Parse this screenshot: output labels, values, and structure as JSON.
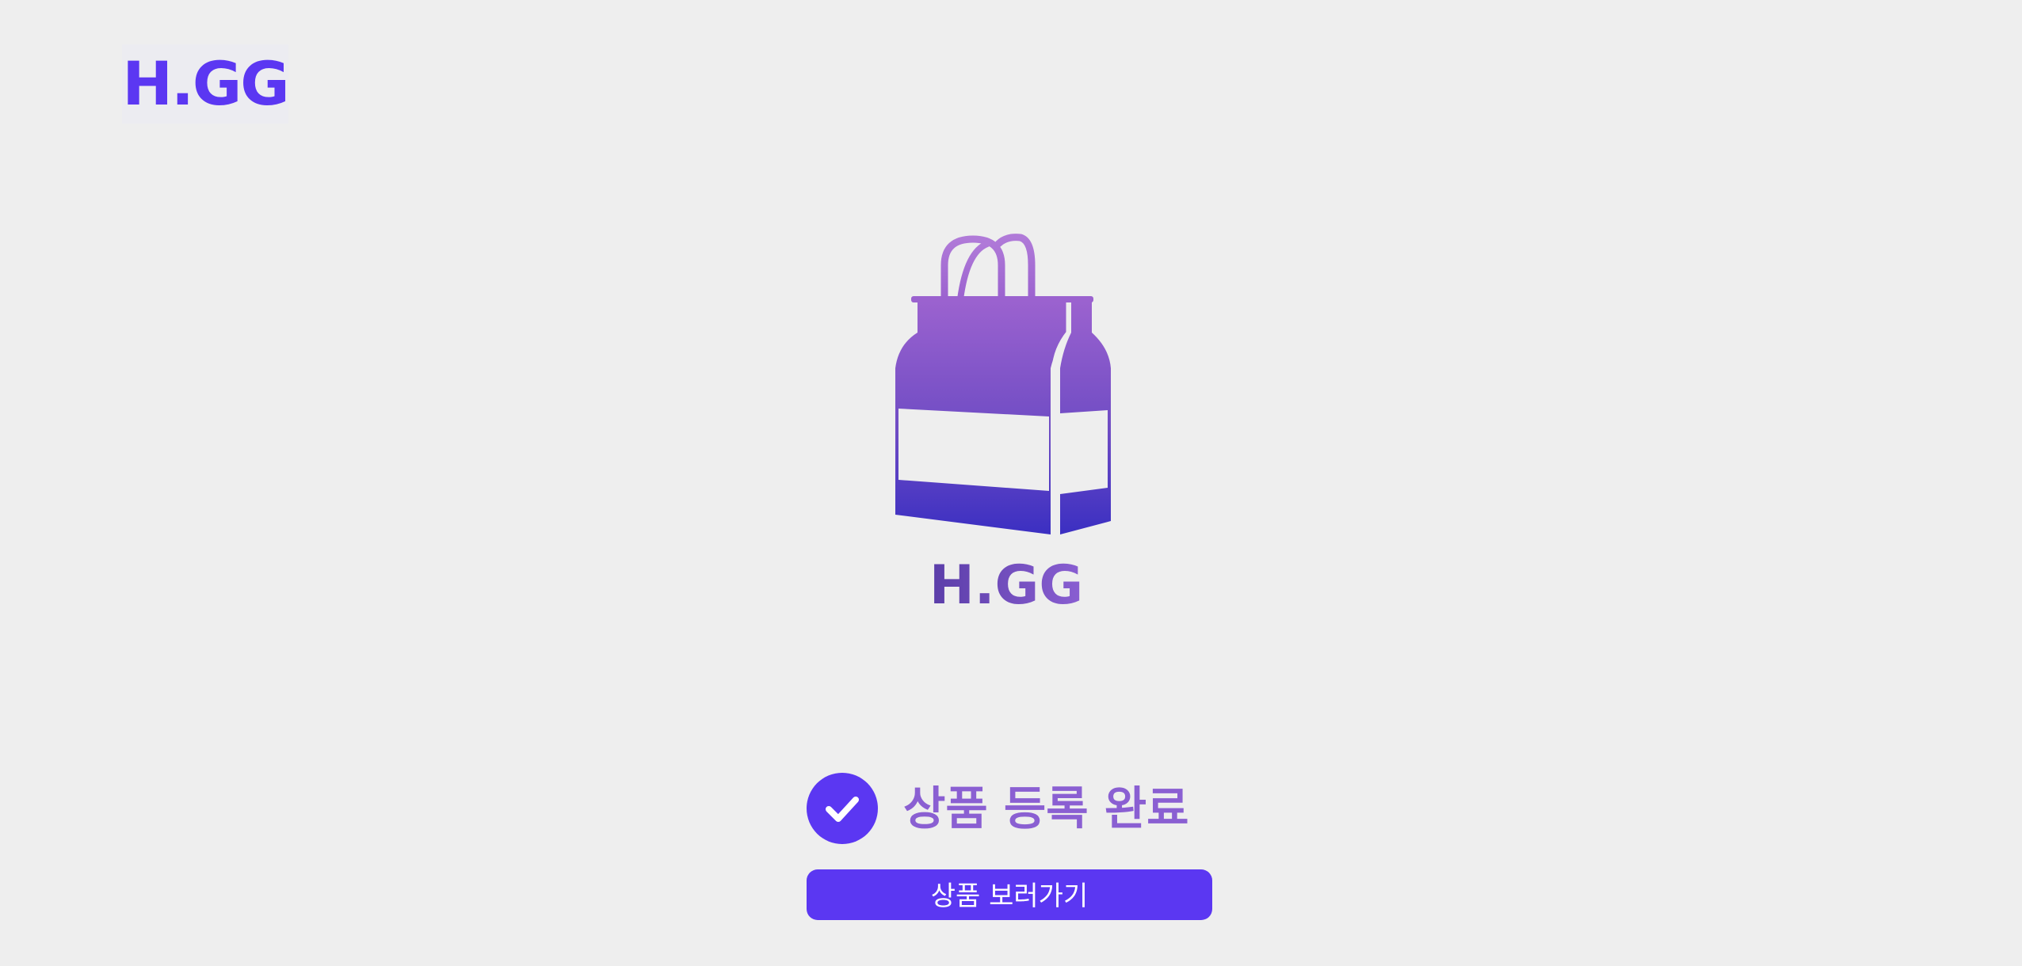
{
  "header": {
    "logo_text": "H.GG"
  },
  "hero": {
    "logo_icon": "shopping-bag-icon",
    "logo_wordmark": "H.GG"
  },
  "status": {
    "icon": "check-icon",
    "title": "상품 등록 완료"
  },
  "actions": {
    "view_product_label": "상품 보러가기"
  },
  "colors": {
    "brand": "#5b37f2",
    "title": "#8a5fd2",
    "background": "#eeeeee",
    "bag_top": "#9b62cf",
    "bag_bottom": "#3b2fc2"
  }
}
